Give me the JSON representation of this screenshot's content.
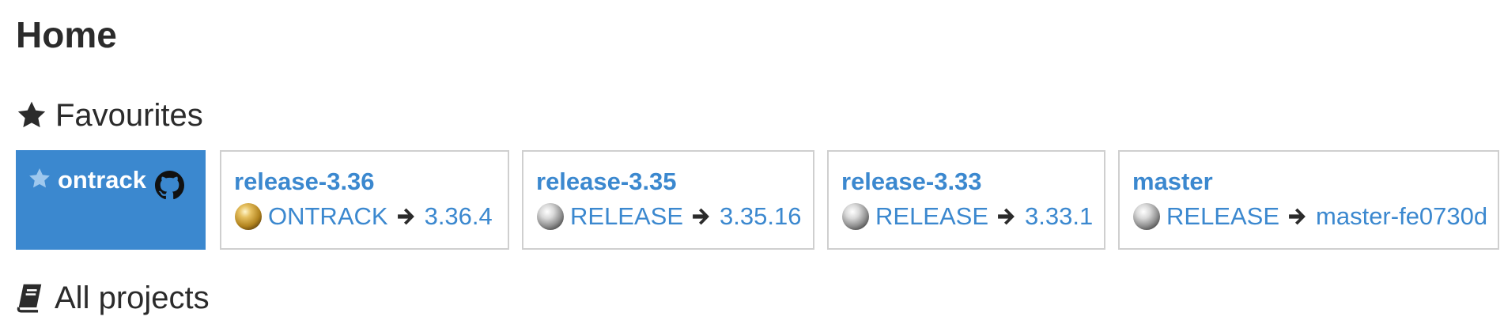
{
  "page": {
    "title": "Home"
  },
  "favourites": {
    "heading": "Favourites",
    "icon": "star-icon",
    "project": {
      "name": "ontrack",
      "star_icon": "star-icon",
      "scm_icon": "github-icon",
      "background_color": "#3b88cf"
    },
    "branches": [
      {
        "name": "release-3.36",
        "promotion": "ONTRACK",
        "promotion_icon": "gold-medal-icon",
        "build": "3.36.4"
      },
      {
        "name": "release-3.35",
        "promotion": "RELEASE",
        "promotion_icon": "silver-medal-icon",
        "build": "3.35.16"
      },
      {
        "name": "release-3.33",
        "promotion": "RELEASE",
        "promotion_icon": "silver-medal-icon",
        "build": "3.33.1"
      },
      {
        "name": "master",
        "promotion": "RELEASE",
        "promotion_icon": "silver-medal-icon",
        "build": "master-fe0730d"
      }
    ]
  },
  "all_projects": {
    "heading": "All projects",
    "icon": "book-icon"
  },
  "colors": {
    "link": "#3b88cf",
    "text": "#2b2b2b",
    "card_border": "#cfcfcf"
  }
}
